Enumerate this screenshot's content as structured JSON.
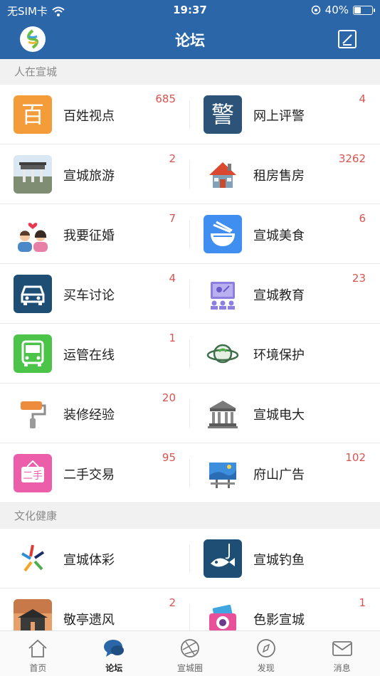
{
  "status_bar": {
    "carrier": "无SIM卡",
    "time": "19:37",
    "battery": "40%",
    "battery_level": 0.4
  },
  "nav": {
    "title": "论坛"
  },
  "sections": [
    {
      "title": "人在宣城",
      "items": [
        {
          "label": "百姓视点",
          "count": "685",
          "icon": "bai-char-icon"
        },
        {
          "label": "网上评警",
          "count": "4",
          "icon": "jing-char-icon"
        },
        {
          "label": "宣城旅游",
          "count": "2",
          "icon": "gate-photo-icon"
        },
        {
          "label": "租房售房",
          "count": "3262",
          "icon": "house-icon"
        },
        {
          "label": "我要征婚",
          "count": "7",
          "icon": "couple-heart-icon"
        },
        {
          "label": "宣城美食",
          "count": "6",
          "icon": "noodle-bowl-icon"
        },
        {
          "label": "买车讨论",
          "count": "4",
          "icon": "car-icon"
        },
        {
          "label": "宣城教育",
          "count": "23",
          "icon": "classroom-icon"
        },
        {
          "label": "运管在线",
          "count": "1",
          "icon": "bus-icon"
        },
        {
          "label": "环境保护",
          "count": "",
          "icon": "planet-leaf-icon"
        },
        {
          "label": "装修经验",
          "count": "20",
          "icon": "paint-roller-icon"
        },
        {
          "label": "宣城电大",
          "count": "",
          "icon": "university-building-icon"
        },
        {
          "label": "二手交易",
          "count": "95",
          "icon": "secondhand-sign-icon"
        },
        {
          "label": "府山广告",
          "count": "102",
          "icon": "billboard-icon"
        }
      ]
    },
    {
      "title": "文化健康",
      "items": [
        {
          "label": "宣城体彩",
          "count": "",
          "icon": "lottery-star-icon"
        },
        {
          "label": "宣城钓鱼",
          "count": "",
          "icon": "fishing-icon"
        },
        {
          "label": "敬亭遗风",
          "count": "2",
          "icon": "pavilion-photo-icon"
        },
        {
          "label": "色影宣城",
          "count": "1",
          "icon": "camera-icon"
        }
      ]
    }
  ],
  "tabs": [
    {
      "label": "首页",
      "icon": "home-icon"
    },
    {
      "label": "论坛",
      "icon": "chat-bubble-icon",
      "active": true
    },
    {
      "label": "宣城圈",
      "icon": "aperture-icon"
    },
    {
      "label": "发现",
      "icon": "compass-icon"
    },
    {
      "label": "消息",
      "icon": "envelope-icon"
    }
  ],
  "colors": {
    "brand": "#2a66a8",
    "count": "#d9534f"
  }
}
